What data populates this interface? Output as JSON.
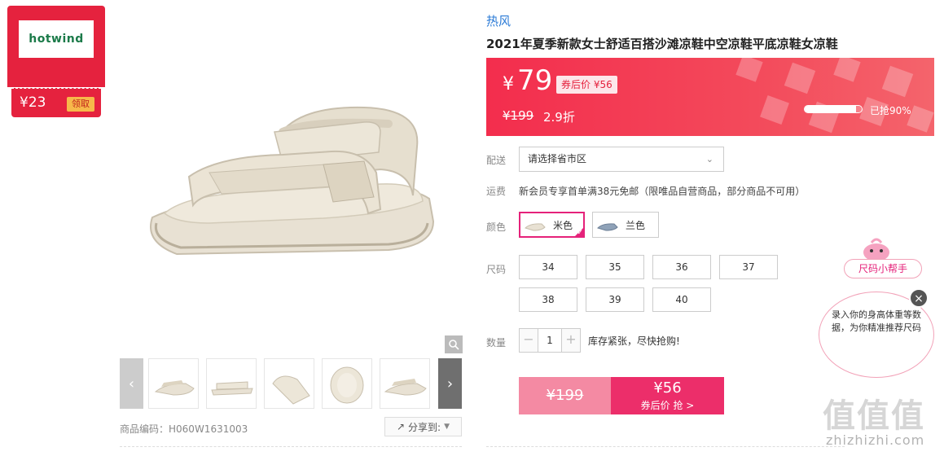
{
  "brand_badge": {
    "logo": "hotwind",
    "coupon_value": "¥23",
    "claim_label": "领取"
  },
  "colors": {
    "accent_red": "#e5223e",
    "accent_pink": "#ec2e6a",
    "link_blue": "#2a7ad6"
  },
  "gallery": {
    "zoom_icon": "magnifier-icon",
    "prev_icon": "chevron-left-icon",
    "next_icon": "chevron-right-icon",
    "thumbnail_count": 5
  },
  "product_code": {
    "label": "商品编码：",
    "value": "H060W1631003"
  },
  "share": {
    "label": "分享到:"
  },
  "product": {
    "brand": "热风",
    "title": "2021年夏季新款女士舒适百搭沙滩凉鞋中空凉鞋平底凉鞋女凉鞋"
  },
  "price": {
    "currency": "¥",
    "current": "79",
    "after_coupon": "券后价 ¥56",
    "original": "¥199",
    "discount": "2.9折",
    "sold_percent": 90,
    "sold_text": "已抢90%"
  },
  "delivery": {
    "label": "配送",
    "placeholder": "请选择省市区"
  },
  "shipping": {
    "label": "运费",
    "text": "新会员专享首单满38元免邮（限唯品自营商品，部分商品不可用）"
  },
  "color": {
    "label": "颜色",
    "options": [
      {
        "name": "米色",
        "selected": true
      },
      {
        "name": "兰色",
        "selected": false
      }
    ]
  },
  "size": {
    "label": "尺码",
    "options": [
      "34",
      "35",
      "36",
      "37",
      "38",
      "39",
      "40"
    ]
  },
  "quantity": {
    "label": "数量",
    "value": "1",
    "minus": "−",
    "plus": "+",
    "stock_text": "库存紧张，尽快抢购!"
  },
  "buy": {
    "original": "¥199",
    "price": "¥56",
    "subtitle": "券后价 抢 >"
  },
  "size_helper": {
    "title": "尺码小帮手",
    "text": "录入你的身高体重等数据，为你精准推荐尺码",
    "close": "×"
  },
  "watermark": {
    "text": "值值值",
    "url": "zhizhizhi.com"
  }
}
